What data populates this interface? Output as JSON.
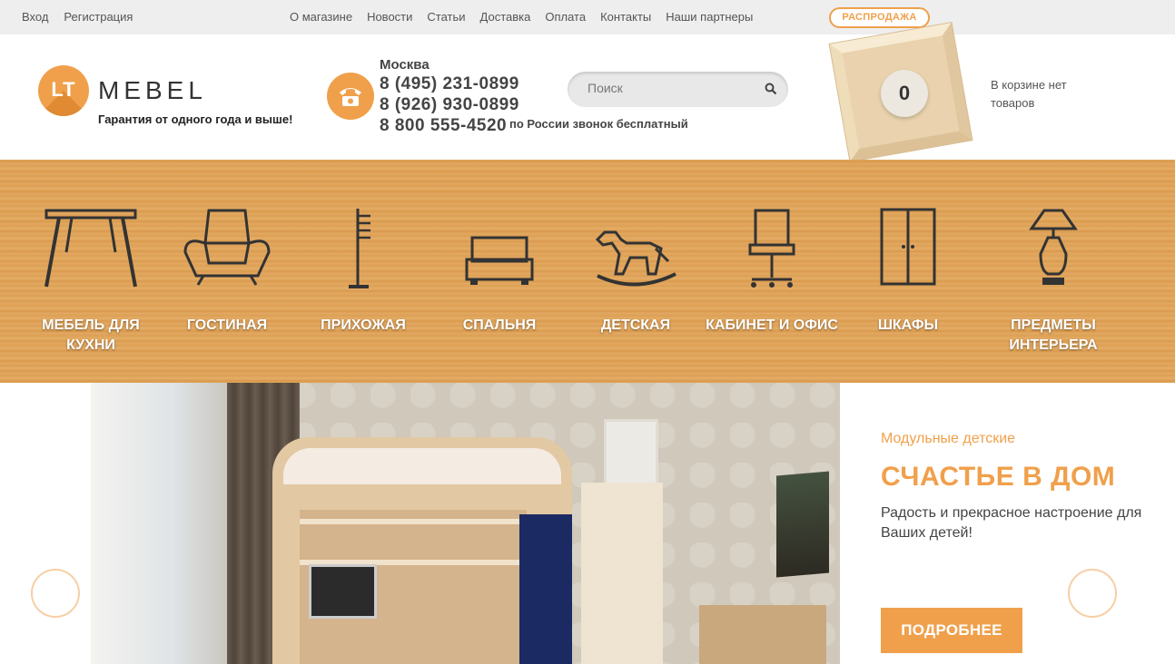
{
  "topbar": {
    "auth": [
      "Вход",
      "Регистрация"
    ],
    "menu": [
      "О магазине",
      "Новости",
      "Статьи",
      "Доставка",
      "Оплата",
      "Контакты",
      "Наши партнеры"
    ],
    "sale": "РАСПРОДАЖА"
  },
  "header": {
    "logo_lt": "LT",
    "logo_name": "MEBEL",
    "tagline": "Гарантия от одного года и выше!",
    "city": "Москва",
    "phones": [
      "8 (495) 231-0899",
      "8 (926) 930-0899",
      "8 800 555-4520"
    ],
    "phone_note": "по России звонок бесплатный",
    "search_placeholder": "Поиск",
    "cart_count": "0",
    "cart_text": "В корзине нет товаров"
  },
  "categories": [
    {
      "label": "МЕБЕЛЬ ДЛЯ КУХНИ",
      "icon": "table-icon"
    },
    {
      "label": "ГОСТИНАЯ",
      "icon": "armchair-icon"
    },
    {
      "label": "ПРИХОЖАЯ",
      "icon": "coat-rack-icon"
    },
    {
      "label": "СПАЛЬНЯ",
      "icon": "bed-icon"
    },
    {
      "label": "ДЕТСКАЯ",
      "icon": "rocking-horse-icon"
    },
    {
      "label": "КАБИНЕТ И ОФИС",
      "icon": "office-chair-icon"
    },
    {
      "label": "ШКАФЫ",
      "icon": "wardrobe-icon"
    },
    {
      "label": "ПРЕДМЕТЫ ИНТЕРЬЕРА",
      "icon": "lamp-icon"
    }
  ],
  "hero": {
    "subtitle": "Модульные детские",
    "title": "СЧАСТЬЕ В ДОМ",
    "description": "Радость и прекрасное настроение для Ваших детей!",
    "button": "ПОДРОБНЕЕ"
  },
  "colors": {
    "accent": "#f0a04b",
    "topbar": "#eeeeee",
    "wood": "#e0a55c"
  }
}
